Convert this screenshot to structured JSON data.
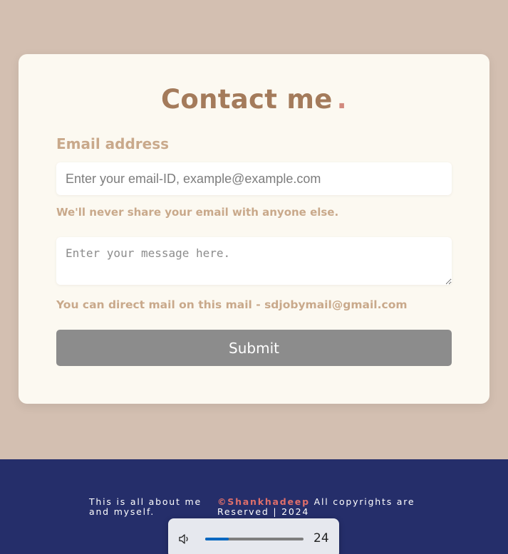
{
  "contact": {
    "title": "Contact me",
    "title_dot": ".",
    "email_label": "Email address",
    "email_placeholder": "Enter your email-ID, example@example.com",
    "email_help": "We'll never share your email with anyone else.",
    "message_placeholder": "Enter your message here.",
    "mail_note": "You can direct mail on this mail - sdjobymail@gmail.com",
    "submit_label": "Submit"
  },
  "footer": {
    "about": "This is all about me and myself.",
    "brand": "©Shankhadeep",
    "copyright": " All copyrights are Reserved | 2024"
  },
  "volume": {
    "icon": "speaker-icon",
    "level": 24,
    "level_label": "24"
  },
  "colors": {
    "page_bg": "#d3bfb1",
    "card_bg": "#fcf9f1",
    "title": "#a47b5b",
    "title_dot": "#d28a7e",
    "label": "#c9a98b",
    "button": "#8c8c8c",
    "footer_bg": "#252e6a",
    "brand": "#e06f6a",
    "volume_accent": "#0067c0"
  }
}
